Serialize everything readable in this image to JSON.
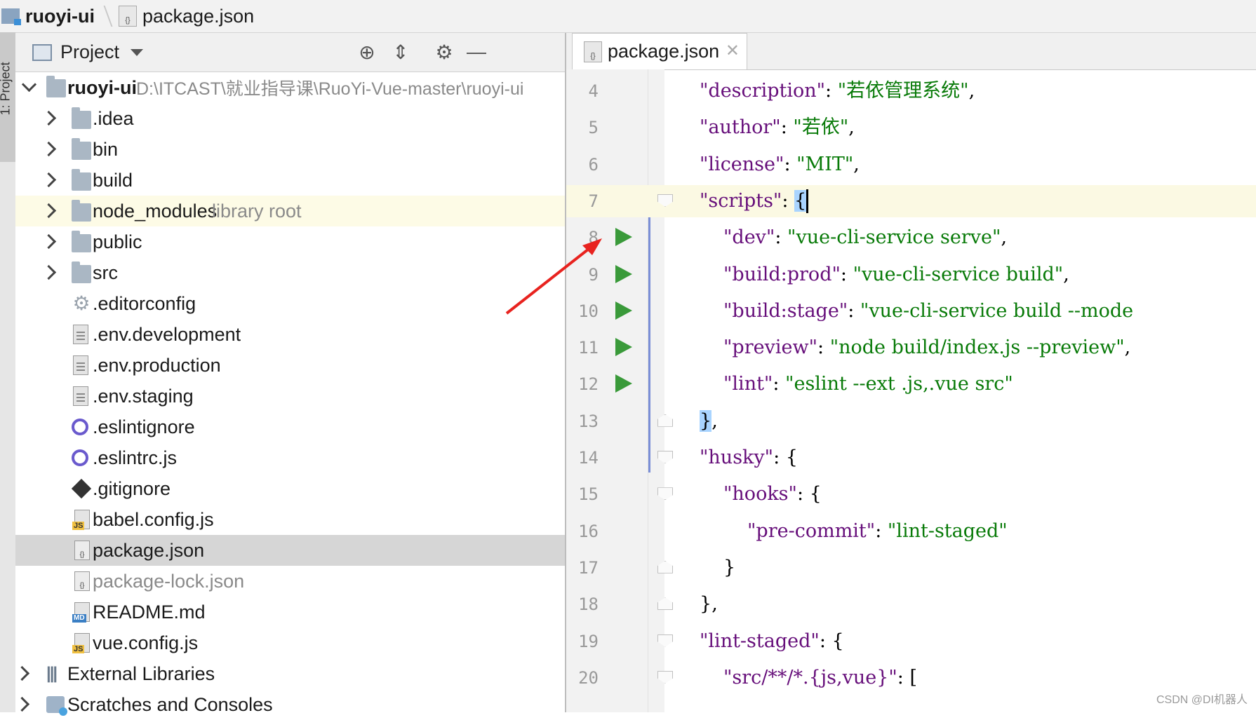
{
  "breadcrumb": {
    "project": "ruoyi-ui",
    "file": "package.json"
  },
  "tool_window": {
    "tab_label": "1: Project"
  },
  "project_panel": {
    "title": "Project",
    "root": {
      "name": "ruoyi-ui",
      "path": "D:\\ITCAST\\就业指导课\\RuoYi-Vue-master\\ruoyi-ui"
    },
    "items": [
      {
        "name": ".idea",
        "icon": "folder-icon"
      },
      {
        "name": "bin",
        "icon": "folder-icon"
      },
      {
        "name": "build",
        "icon": "folder-icon"
      },
      {
        "name": "node_modules",
        "hint": "library root",
        "icon": "folder-icon"
      },
      {
        "name": "public",
        "icon": "folder-icon"
      },
      {
        "name": "src",
        "icon": "folder-icon"
      },
      {
        "name": ".editorconfig",
        "icon": "gear-file-icon"
      },
      {
        "name": ".env.development",
        "icon": "text-file-icon"
      },
      {
        "name": ".env.production",
        "icon": "text-file-icon"
      },
      {
        "name": ".env.staging",
        "icon": "text-file-icon"
      },
      {
        "name": ".eslintignore",
        "icon": "eslint-icon"
      },
      {
        "name": ".eslintrc.js",
        "icon": "eslint-icon"
      },
      {
        "name": ".gitignore",
        "icon": "git-icon"
      },
      {
        "name": "babel.config.js",
        "icon": "js-file-icon"
      },
      {
        "name": "package.json",
        "icon": "json-file-icon"
      },
      {
        "name": "package-lock.json",
        "icon": "json-file-icon"
      },
      {
        "name": "README.md",
        "icon": "markdown-file-icon"
      },
      {
        "name": "vue.config.js",
        "icon": "js-file-icon"
      }
    ],
    "external_libraries": "External Libraries",
    "scratches": "Scratches and Consoles"
  },
  "editor": {
    "tab": "package.json",
    "lines": [
      {
        "n": "4",
        "key": "\"description\"",
        "val": "\"若依管理系统\"",
        "tail": ","
      },
      {
        "n": "5",
        "key": "\"author\"",
        "val": "\"若依\"",
        "tail": ","
      },
      {
        "n": "6",
        "key": "\"license\"",
        "val": "\"MIT\"",
        "tail": ","
      },
      {
        "n": "7",
        "key": "\"scripts\"",
        "open": "{"
      },
      {
        "n": "8",
        "key": "\"dev\"",
        "val": "\"vue-cli-service serve\"",
        "tail": ","
      },
      {
        "n": "9",
        "key": "\"build:prod\"",
        "val": "\"vue-cli-service build\"",
        "tail": ","
      },
      {
        "n": "10",
        "key": "\"build:stage\"",
        "val": "\"vue-cli-service build --mode"
      },
      {
        "n": "11",
        "key": "\"preview\"",
        "val": "\"node build/index.js --preview\"",
        "tail": ","
      },
      {
        "n": "12",
        "key": "\"lint\"",
        "val": "\"eslint --ext .js,.vue src\""
      },
      {
        "n": "13",
        "close": "}",
        "tail": ","
      },
      {
        "n": "14",
        "key": "\"husky\"",
        "open": "{"
      },
      {
        "n": "15",
        "key": "\"hooks\"",
        "open": "{"
      },
      {
        "n": "16",
        "key": "\"pre-commit\"",
        "val": "\"lint-staged\""
      },
      {
        "n": "17",
        "close": "}"
      },
      {
        "n": "18",
        "close": "}",
        "tail": ","
      },
      {
        "n": "19",
        "key": "\"lint-staged\"",
        "open": "{"
      },
      {
        "n": "20",
        "key": "\"src/**/*.{js,vue}\"",
        "open": "["
      }
    ]
  },
  "watermark": "CSDN @DI机器人",
  "colors": {
    "key": "#660e7a",
    "string": "#087a08",
    "run": "#3a9a3a",
    "annotation": "#e8231f"
  }
}
